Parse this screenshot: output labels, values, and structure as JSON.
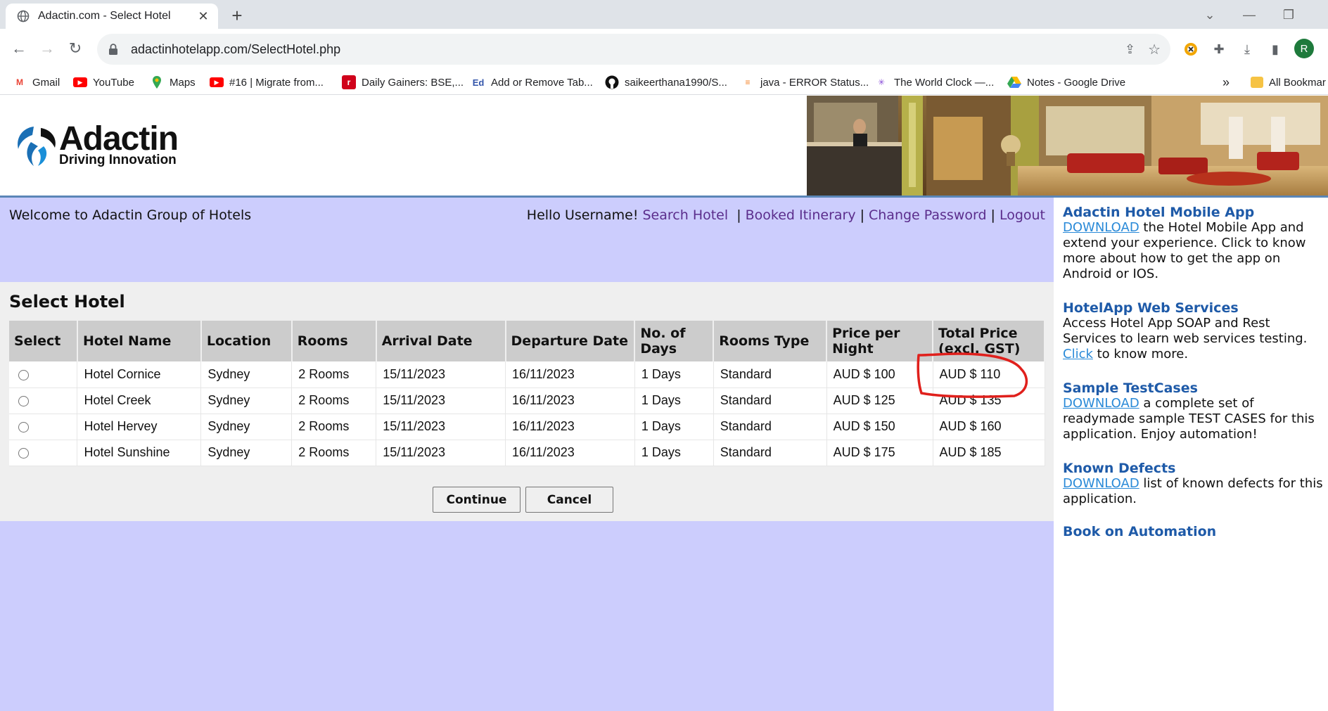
{
  "browser": {
    "tab_title": "Adactin.com - Select Hotel",
    "tab_close": "✕",
    "new_tab": "+",
    "url": "adactinhotelapp.com/SelectHotel.php",
    "profile_initial": "R",
    "bookmarks": [
      {
        "label": "Gmail",
        "icon": "gmail-icon",
        "glyph": "M",
        "color": "#ea4335"
      },
      {
        "label": "YouTube",
        "icon": "youtube-icon",
        "glyph": "▶",
        "color": "#ff0000"
      },
      {
        "label": "Maps",
        "icon": "maps-icon",
        "glyph": "●",
        "color": "#34a853"
      },
      {
        "label": "#16 | Migrate from...",
        "icon": "youtube-icon",
        "glyph": "▶",
        "color": "#ff0000"
      },
      {
        "label": "Daily Gainers: BSE,...",
        "icon": "rediff-icon",
        "glyph": "r",
        "color": "#d0021b"
      },
      {
        "label": "Add or Remove Tab...",
        "icon": "ed-icon",
        "glyph": "Ed",
        "color": "#3355aa"
      },
      {
        "label": "saikeerthana1990/S...",
        "icon": "github-icon",
        "glyph": "●",
        "color": "#111111"
      },
      {
        "label": "java - ERROR Status...",
        "icon": "stackoverflow-icon",
        "glyph": "≡",
        "color": "#f48024"
      },
      {
        "label": "The World Clock —...",
        "icon": "worldclock-icon",
        "glyph": "✳",
        "color": "#8a4fd8"
      },
      {
        "label": "Notes - Google Drive",
        "icon": "google-drive-icon",
        "glyph": "▲",
        "color": "#fbbc04"
      }
    ],
    "bookmarks_overflow": "»",
    "all_bookmarks": "All Bookmar"
  },
  "site": {
    "logo_name": "Adactin",
    "logo_tagline": "Driving Innovation",
    "welcome": "Welcome to Adactin Group of Hotels",
    "greeting": "Hello Username!",
    "nav": {
      "search_hotel": "Search Hotel",
      "booked_itinerary": "Booked Itinerary",
      "change_password": "Change Password",
      "logout": "Logout",
      "separator": "|"
    }
  },
  "select_hotel": {
    "title": "Select Hotel",
    "columns": [
      "Select",
      "Hotel Name",
      "Location",
      "Rooms",
      "Arrival Date",
      "Departure Date",
      "No. of Days",
      "Rooms Type",
      "Price per Night",
      "Total Price (excl. GST)"
    ],
    "rows": [
      {
        "hotel": "Hotel Cornice",
        "location": "Sydney",
        "rooms": "2 Rooms",
        "arrival": "15/11/2023",
        "departure": "16/11/2023",
        "days": "1 Days",
        "room_type": "Standard",
        "price_night": "AUD $ 100",
        "total": "AUD $ 110"
      },
      {
        "hotel": "Hotel Creek",
        "location": "Sydney",
        "rooms": "2 Rooms",
        "arrival": "15/11/2023",
        "departure": "16/11/2023",
        "days": "1 Days",
        "room_type": "Standard",
        "price_night": "AUD $ 125",
        "total": "AUD $ 135"
      },
      {
        "hotel": "Hotel Hervey",
        "location": "Sydney",
        "rooms": "2 Rooms",
        "arrival": "15/11/2023",
        "departure": "16/11/2023",
        "days": "1 Days",
        "room_type": "Standard",
        "price_night": "AUD $ 150",
        "total": "AUD $ 160"
      },
      {
        "hotel": "Hotel Sunshine",
        "location": "Sydney",
        "rooms": "2 Rooms",
        "arrival": "15/11/2023",
        "departure": "16/11/2023",
        "days": "1 Days",
        "room_type": "Standard",
        "price_night": "AUD $ 175",
        "total": "AUD $ 185"
      }
    ],
    "continue_label": "Continue",
    "cancel_label": "Cancel"
  },
  "sidebar": {
    "mobile_app": {
      "title": "Adactin Hotel Mobile App",
      "link": "DOWNLOAD",
      "text": " the Hotel Mobile App and extend your experience. Click to know more about how to get the app on Android or IOS."
    },
    "web_services": {
      "title": "HotelApp Web Services",
      "text": "Access Hotel App SOAP and Rest Services to learn web services testing. ",
      "link": "Click",
      "text2": " to know more."
    },
    "testcases": {
      "title": "Sample TestCases",
      "link": "DOWNLOAD",
      "text": " a complete set of readymade sample TEST CASES for this application. Enjoy automation!"
    },
    "defects": {
      "title": "Known Defects",
      "link": "DOWNLOAD",
      "text": " list of known defects for this application."
    },
    "book": {
      "title": "Book on Automation"
    }
  },
  "colors": {
    "main_bg": "#cccdfd",
    "content_bg": "#efefef",
    "nav_link": "#5b2d8c",
    "sidebar_title": "#1e5aa8",
    "sidebar_link": "#2a8ad8",
    "annotation": "#e0201c"
  }
}
